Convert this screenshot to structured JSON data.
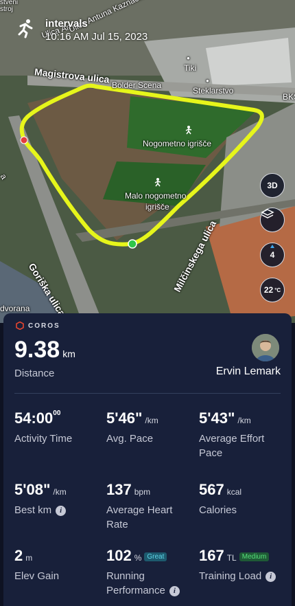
{
  "activity": {
    "title": "intervals",
    "datetime": "10:16 AM Jul 15, 2023"
  },
  "map": {
    "labels": {
      "street_top_left": "Ulica Antuna Kaznačića",
      "street_top_left_short": "Ulica An",
      "street_small_1": "stveni",
      "street_small_2": "stroj",
      "road_magistrova": "Magistrova ulica",
      "bolder_scena": "Bolder Scena",
      "tiki": "Tiki",
      "steklarstvo": "Steklarstvo",
      "bks": "BKS",
      "nogometno": "Nogometno igrišče",
      "malo_line1": "Malo nogometno",
      "malo_line2": "igrišče",
      "road_goriska": "Goriška ulica",
      "road_milcinskega": "Milčinskega ulica",
      "dvorana": "dvorana",
      "side_a": "a"
    },
    "buttons": {
      "view_3d": "3D",
      "compass_value": "4",
      "temperature": "22",
      "temperature_unit": "°C"
    },
    "route_color": "#e6f51b"
  },
  "summary": {
    "brand": "COROS",
    "distance_value": "9.38",
    "distance_unit": "km",
    "distance_label": "Distance",
    "user_name": "Ervin Lemark"
  },
  "stats": [
    {
      "value": "54:00",
      "value_sup": "00",
      "unit": "",
      "label": "Activity Time",
      "badge": "",
      "info": false
    },
    {
      "value": "5'46\"",
      "value_sup": "",
      "unit": "/km",
      "label": "Avg. Pace",
      "badge": "",
      "info": false
    },
    {
      "value": "5'43\"",
      "value_sup": "",
      "unit": "/km",
      "label": "Average Effort Pace",
      "badge": "",
      "info": false
    },
    {
      "value": "5'08\"",
      "value_sup": "",
      "unit": "/km",
      "label": "Best km",
      "badge": "",
      "info": true
    },
    {
      "value": "137",
      "value_sup": "",
      "unit": "bpm",
      "label": "Average Heart Rate",
      "badge": "",
      "info": false
    },
    {
      "value": "567",
      "value_sup": "",
      "unit": "kcal",
      "label": "Calories",
      "badge": "",
      "info": false
    },
    {
      "value": "2",
      "value_sup": "",
      "unit": "m",
      "label": "Elev Gain",
      "badge": "",
      "info": false
    },
    {
      "value": "102",
      "value_sup": "",
      "unit": "%",
      "label": "Running Performance",
      "badge": "Great",
      "info": true
    },
    {
      "value": "167",
      "value_sup": "",
      "unit": "TL",
      "label": "Training Load",
      "badge": "Medium",
      "info": true
    }
  ],
  "colors": {
    "badge_great_bg": "#1d5a6e",
    "badge_great_fg": "#5fd5e8",
    "badge_medium_bg": "#1f5a36",
    "badge_medium_fg": "#55e07a"
  }
}
